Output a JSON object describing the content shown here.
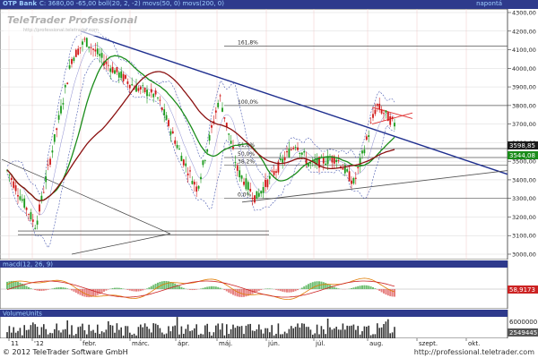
{
  "header": {
    "title": "OTP Bank",
    "quote": "C: 3680,00  -65,00  boll(20, 2, -2)  movs(50, 0)  movs(200, 0)",
    "period": "napontá"
  },
  "watermark": {
    "brand": "TeleTrader Professional",
    "url": "http://professional.teletrader.com"
  },
  "price_chart": {
    "y_ticks": [
      "4300,00",
      "4200,00",
      "4100,00",
      "4000,00",
      "3900,00",
      "3800,00",
      "3700,00",
      "3600,00",
      "3500,00",
      "3400,00",
      "3300,00",
      "3200,00",
      "3100,00",
      "3000,00"
    ],
    "fib_labels": [
      "161,8%",
      "100,0%",
      "61,8%",
      "50,0%",
      "38,2%",
      "0,0%"
    ],
    "price_tags": [
      "3598,85",
      "3544,08"
    ],
    "colors": {
      "last_price_tag": "#1a1a1a",
      "ma50_tag": "#1a8c1a",
      "ma50": "#1a8c1a",
      "ma200": "#8b1010",
      "trend": "#1f2f8f",
      "bollinger": "#4a5ab0"
    }
  },
  "macd": {
    "label": "macd(12, 26, 9)",
    "tag": "58,9173"
  },
  "volume": {
    "label": "VolumeUnits",
    "ticks": [
      "6000000",
      "2549445"
    ]
  },
  "x_axis": {
    "labels": [
      "11",
      "'12",
      "febr.",
      "márc.",
      "ápr.",
      "máj.",
      "jún.",
      "júl.",
      "aug.",
      "szept.",
      "okt."
    ]
  },
  "footer": {
    "copyright": "© 2012 TeleTrader Software GmbH",
    "url": "http://professional.teletrader.com"
  }
}
